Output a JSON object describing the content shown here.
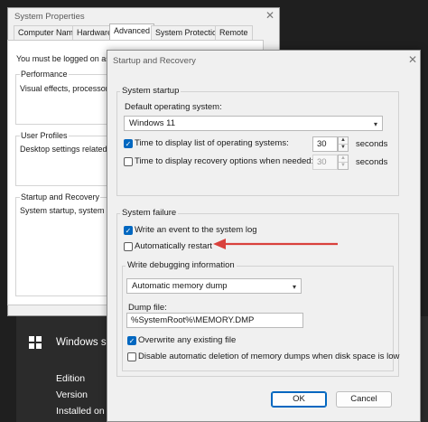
{
  "background": {
    "title": "Windows spe",
    "rows": [
      "Edition",
      "Version",
      "Installed on"
    ]
  },
  "system_properties": {
    "title": "System Properties",
    "tabs": [
      "Computer Name",
      "Hardware",
      "Advanced",
      "System Protection",
      "Remote"
    ],
    "active_tab": "Advanced",
    "warning_text": "You must be logged on as",
    "groups": [
      {
        "label": "Performance",
        "text": "Visual effects, processor s"
      },
      {
        "label": "User Profiles",
        "text": "Desktop settings related t"
      },
      {
        "label": "Startup and Recovery",
        "text": "System startup, system fa"
      }
    ]
  },
  "startup_recovery": {
    "title": "Startup and Recovery",
    "system_startup": {
      "group_label": "System startup",
      "default_os_label": "Default operating system:",
      "default_os_value": "Windows 11",
      "display_list_label": "Time to display list of operating systems:",
      "display_list_value": "30",
      "display_list_checked": true,
      "display_recovery_label": "Time to display recovery options when needed:",
      "display_recovery_value": "30",
      "display_recovery_checked": false,
      "seconds_label": "seconds"
    },
    "system_failure": {
      "group_label": "System failure",
      "write_event_label": "Write an event to the system log",
      "write_event_checked": true,
      "auto_restart_label": "Automatically restart",
      "auto_restart_checked": false,
      "debug": {
        "group_label": "Write debugging information",
        "dump_type": "Automatic memory dump",
        "dump_file_label": "Dump file:",
        "dump_file_value": "%SystemRoot%\\MEMORY.DMP",
        "overwrite_label": "Overwrite any existing file",
        "overwrite_checked": true,
        "disable_auto_delete_label": "Disable automatic deletion of memory dumps when disk space is low",
        "disable_auto_delete_checked": false
      }
    },
    "buttons": {
      "ok": "OK",
      "cancel": "Cancel"
    }
  },
  "icons": {
    "close": "close-icon",
    "check": "check-icon",
    "chevron": "chevron-down-icon",
    "spin_up": "spin-up-icon",
    "spin_down": "spin-down-icon",
    "arrow": "red-arrow-annotation",
    "windows_logo": "windows-logo-icon"
  },
  "colors": {
    "accent": "#0067c0",
    "annotation_arrow": "#d9413c",
    "dark_background": "#1f1f1f"
  }
}
